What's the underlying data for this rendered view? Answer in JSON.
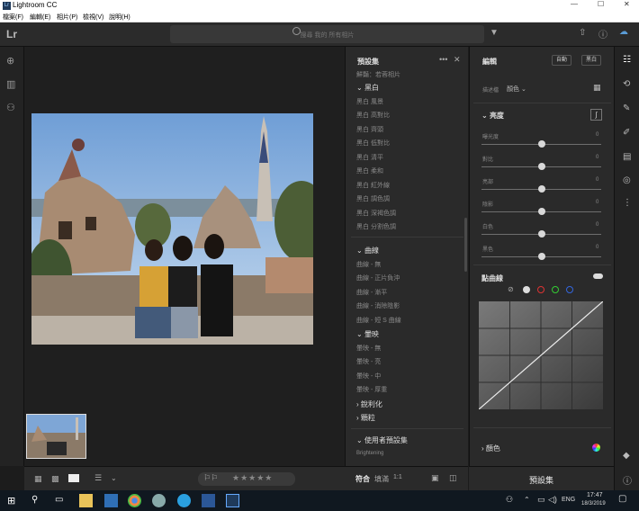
{
  "window": {
    "title": "Lightroom CC",
    "app_badge": "Lr",
    "controls": [
      "—",
      "☐",
      "✕"
    ]
  },
  "menu": [
    "檔案(F)",
    "編輯(E)",
    "相片(P)",
    "檢視(V)",
    "說明(H)"
  ],
  "topbar": {
    "logo": "Lr",
    "search_placeholder": "搜尋 我的 所有相片",
    "icons": [
      "filter-icon",
      "share-icon",
      "help-icon",
      "cloud-icon"
    ]
  },
  "left_rail": [
    "add-icon",
    "library-icon",
    "people-icon"
  ],
  "presets_panel": {
    "title": "預設集",
    "top_item": "鮮豔：若蓉相片",
    "groups": [
      {
        "name": "黑白",
        "expanded": true,
        "items": [
          "黑白 風景",
          "黑白 高對比",
          "黑白 齊頭",
          "黑白 低對比",
          "黑白 清平",
          "黑白 柔和",
          "黑白 紅外線",
          "黑白 調色調",
          "黑白 深褐色調",
          "黑白 分割色調"
        ]
      },
      {
        "name": "曲線",
        "expanded": true,
        "items": [
          "曲線 - 無",
          "曲線 - 正片負沖",
          "曲線 - 漸平",
          "曲線 - 消除陰影",
          "曲線 - 短 S 曲線"
        ]
      },
      {
        "name": "暈映",
        "expanded": true,
        "items": [
          "暈映 - 無",
          "暈映 - 亮",
          "暈映 - 中",
          "暈映 - 厚重"
        ]
      },
      {
        "name": "銳利化",
        "expanded": false,
        "items": []
      },
      {
        "name": "顆粒",
        "expanded": false,
        "items": []
      }
    ],
    "user_presets": {
      "name": "使用者預設集",
      "item": "Brightening"
    }
  },
  "edit_panel": {
    "title": "編輯",
    "auto": "自動",
    "bw": "黑白",
    "profile_label": "描述檔",
    "profile_value": "顏色",
    "light_section": "亮度",
    "sliders": [
      {
        "label": "曝光度",
        "value": "0",
        "pos": 0.5
      },
      {
        "label": "對比",
        "value": "0",
        "pos": 0.5
      },
      {
        "label": "亮部",
        "value": "0",
        "pos": 0.5
      },
      {
        "label": "陰影",
        "value": "0",
        "pos": 0.5
      },
      {
        "label": "白色",
        "value": "0",
        "pos": 0.5
      },
      {
        "label": "黑色",
        "value": "0",
        "pos": 0.5
      }
    ],
    "curve_title": "點曲線",
    "color_section": "顏色",
    "footer": "預設集"
  },
  "bottombar": {
    "fit": "符合",
    "fill": "填滿",
    "ratio": "1:1"
  },
  "right_rail": [
    "edit-icon",
    "crop-icon",
    "heal-icon",
    "brush-icon",
    "linear-gradient-icon",
    "radial-gradient-icon",
    "more-icon",
    "tag-icon",
    "info-icon"
  ],
  "taskbar": {
    "lang": "ENG",
    "time": "17:47",
    "date": "18/3/2019"
  }
}
